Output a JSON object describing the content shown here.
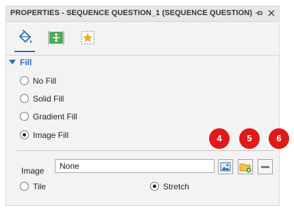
{
  "title": "PROPERTIES - SEQUENCE QUESTION_1 (SEQUENCE QUESTION)",
  "titlebar_icons": [
    "pin-icon",
    "close-icon"
  ],
  "tabs": [
    {
      "icon": "paint-bucket-icon",
      "active": true
    },
    {
      "icon": "size-position-icon",
      "active": false
    },
    {
      "icon": "star-effects-icon",
      "active": false
    }
  ],
  "fill": {
    "section_label": "Fill",
    "options": [
      {
        "label": "No Fill",
        "checked": false
      },
      {
        "label": "Solid Fill",
        "checked": false
      },
      {
        "label": "Gradient Fill",
        "checked": false
      },
      {
        "label": "Image Fill",
        "checked": true
      }
    ]
  },
  "image": {
    "label": "Image",
    "value": "None",
    "buttons": [
      "image-preview-icon",
      "open-folder-icon",
      "remove-icon"
    ]
  },
  "layout_options": [
    {
      "label": "Tile",
      "checked": false
    },
    {
      "label": "Stretch",
      "checked": true
    }
  ],
  "badges": [
    "4",
    "5",
    "6"
  ],
  "colors": {
    "accent": "#2b6cb0",
    "badge": "#e01919"
  }
}
